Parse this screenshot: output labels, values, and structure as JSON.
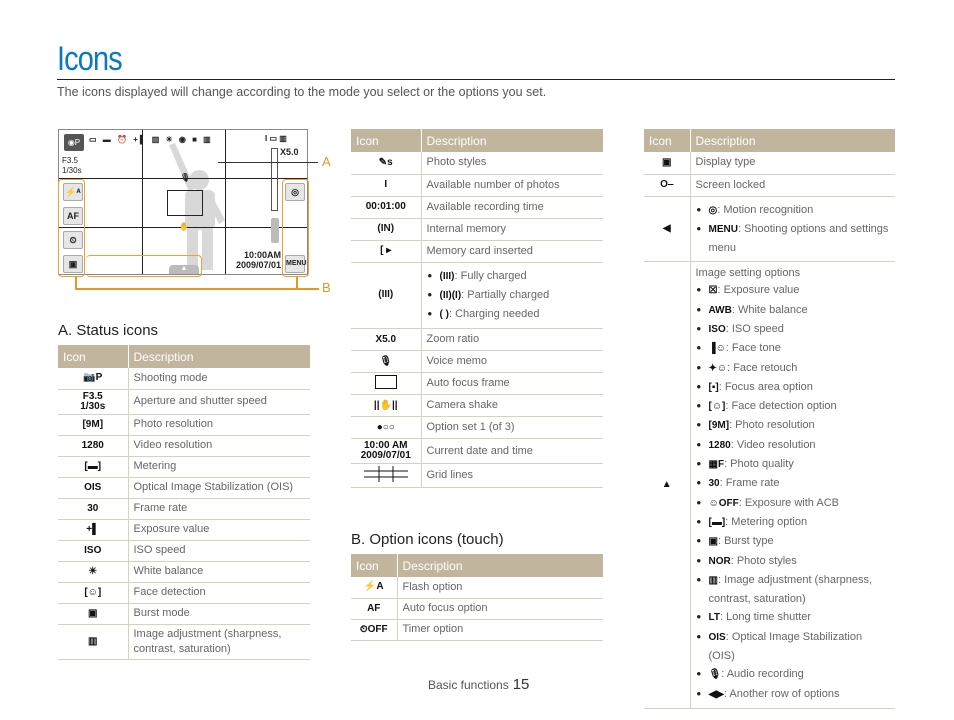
{
  "page": {
    "title": "Icons",
    "subtitle": "The icons displayed will change according to the mode you select or the options you set.",
    "footer_section": "Basic functions",
    "page_number": "15"
  },
  "screen": {
    "aperture": "F3.5",
    "shutter": "1/30s",
    "zoom": "X5.0",
    "time": "10:00AM",
    "date": "2009/07/01",
    "menu_label": "MENU",
    "af_label": "AF",
    "callout_a": "A",
    "callout_b": "B"
  },
  "status_icons": {
    "heading": "A. Status icons",
    "col_icon": "Icon",
    "col_desc": "Description",
    "rows": [
      {
        "icon": "camera-p",
        "glyph": "📷P",
        "desc": "Shooting mode"
      },
      {
        "icon": "aperture-shutter",
        "glyph": "F3.5\n1/30s",
        "desc": "Aperture and shutter speed"
      },
      {
        "icon": "photo-resolution",
        "glyph": "[9M]",
        "desc": "Photo resolution"
      },
      {
        "icon": "video-resolution",
        "glyph": "1280",
        "desc": "Video resolution"
      },
      {
        "icon": "metering",
        "glyph": "[▬]",
        "desc": "Metering"
      },
      {
        "icon": "ois",
        "glyph": "OIS",
        "desc": "Optical Image Stabilization (OIS)"
      },
      {
        "icon": "frame-rate",
        "glyph": "30",
        "desc": "Frame rate"
      },
      {
        "icon": "exposure-value",
        "glyph": "+▌",
        "desc": "Exposure value"
      },
      {
        "icon": "iso-speed",
        "glyph": "ISO",
        "desc": "ISO speed"
      },
      {
        "icon": "white-balance",
        "glyph": "☀",
        "desc": "White balance"
      },
      {
        "icon": "face-detection",
        "glyph": "[☺]",
        "desc": "Face detection"
      },
      {
        "icon": "burst-mode",
        "glyph": "▣",
        "desc": "Burst mode"
      },
      {
        "icon": "image-adjustment",
        "glyph": "▥",
        "desc": "Image adjustment (sharpness, contrast, saturation)"
      }
    ]
  },
  "middle_table": {
    "col_icon": "Icon",
    "col_desc": "Description",
    "rows": [
      {
        "icon": "photo-styles",
        "glyph": "✎s",
        "desc": "Photo styles"
      },
      {
        "icon": "available-photos",
        "glyph": "I",
        "desc": "Available number of photos"
      },
      {
        "icon": "recording-time",
        "glyph": "00:01:00",
        "desc": "Available recording time"
      },
      {
        "icon": "internal-memory",
        "glyph": "(IN)",
        "desc": "Internal memory"
      },
      {
        "icon": "memory-card",
        "glyph": "[ ▸",
        "desc": "Memory card inserted"
      },
      {
        "icon": "battery",
        "glyph": "(III)",
        "bullets": [
          {
            "glyph": "(III)",
            "text": ": Fully charged"
          },
          {
            "glyph": "(II)(I)",
            "text": ": Partially charged"
          },
          {
            "glyph": "(  )",
            "text": ": Charging needed"
          }
        ]
      },
      {
        "icon": "zoom-ratio",
        "glyph": "X5.0",
        "desc": "Zoom ratio"
      },
      {
        "icon": "voice-memo",
        "glyph": "🎙",
        "desc": "Voice memo"
      },
      {
        "icon": "af-frame",
        "glyph": "",
        "desc": "Auto focus frame"
      },
      {
        "icon": "camera-shake",
        "glyph": "||✋||",
        "desc": "Camera shake"
      },
      {
        "icon": "option-set",
        "glyph": "●○○",
        "desc": "Option set 1 (of 3)"
      },
      {
        "icon": "date-time",
        "glyph": "10:00 AM\n2009/07/01",
        "desc": "Current date and time"
      },
      {
        "icon": "grid-lines",
        "glyph": "",
        "desc": "Grid lines"
      }
    ]
  },
  "option_icons": {
    "heading": "B. Option icons (touch)",
    "col_icon": "Icon",
    "col_desc": "Description",
    "rows": [
      {
        "icon": "flash",
        "glyph": "⚡A",
        "desc": "Flash option"
      },
      {
        "icon": "af",
        "glyph": "AF",
        "desc": "Auto focus option"
      },
      {
        "icon": "timer",
        "glyph": "⏲OFF",
        "desc": "Timer option"
      }
    ]
  },
  "right_table": {
    "col_icon": "Icon",
    "col_desc": "Description",
    "rows": [
      {
        "icon": "display-type",
        "glyph": "▣",
        "desc": "Display type"
      },
      {
        "icon": "screen-locked",
        "glyph": "O‒",
        "desc": "Screen locked"
      },
      {
        "icon": "left-arrow",
        "glyph": "◀",
        "bullets": [
          {
            "glyph": "◎",
            "text": ": Motion recognition"
          },
          {
            "glyph": "MENU",
            "text": ": Shooting options and settings menu"
          }
        ]
      },
      {
        "icon": "up-arrow",
        "glyph": "▲",
        "intro": "Image setting options",
        "bullets": [
          {
            "glyph": "☒",
            "text": ": Exposure value"
          },
          {
            "glyph": "AWB",
            "text": ": White balance"
          },
          {
            "glyph": "ISO",
            "text": ": ISO speed"
          },
          {
            "glyph": "▐☺",
            "text": ": Face tone"
          },
          {
            "glyph": "✦☺",
            "text": ": Face retouch"
          },
          {
            "glyph": "[▪]",
            "text": ": Focus area option"
          },
          {
            "glyph": "[☺]",
            "text": ": Face detection option"
          },
          {
            "glyph": "[9M]",
            "text": ": Photo resolution"
          },
          {
            "glyph": "1280",
            "text": ": Video resolution"
          },
          {
            "glyph": "▦F",
            "text": ": Photo quality"
          },
          {
            "glyph": "30",
            "text": ": Frame rate"
          },
          {
            "glyph": "☺OFF",
            "text": ": Exposure with ACB"
          },
          {
            "glyph": "[▬]",
            "text": ": Metering option"
          },
          {
            "glyph": "▣",
            "text": ": Burst type"
          },
          {
            "glyph": "NOR",
            "text": ": Photo styles"
          },
          {
            "glyph": "▥",
            "text": ": Image adjustment (sharpness, contrast, saturation)"
          },
          {
            "glyph": "LT",
            "text": ": Long time shutter"
          },
          {
            "glyph": "OIS",
            "text": ": Optical Image Stabilization (OIS)"
          },
          {
            "glyph": "🎙",
            "text": ": Audio recording"
          },
          {
            "glyph": "◀▶",
            "text": ": Another row of options"
          }
        ]
      }
    ]
  },
  "colors": {
    "title": "#0a78c2",
    "table_header": "#c2b59d",
    "callout": "#e8961e"
  }
}
